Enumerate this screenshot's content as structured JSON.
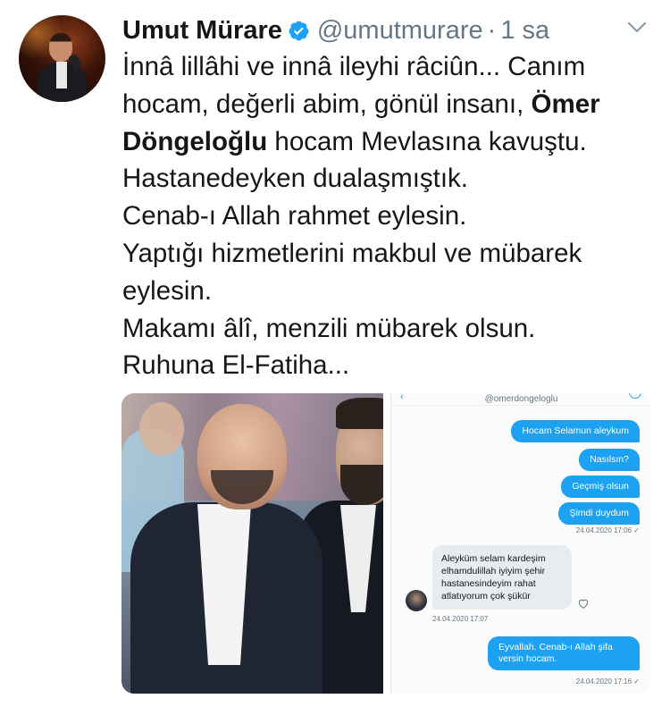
{
  "tweet": {
    "author_name": "Umut Mürare",
    "handle": "@umutmurare",
    "separator": "·",
    "time": "1 sa",
    "lines": [
      {
        "pre": "İnnâ lillâhi ve innâ ileyhi râciûn... Canım",
        "bold": "",
        "post": ""
      },
      {
        "pre": "hocam, değerli abim, gönül insanı, ",
        "bold": "Ömer",
        "post": ""
      },
      {
        "pre": "",
        "bold": "Döngeloğlu",
        "post": " hocam Mevlasına kavuştu."
      },
      {
        "pre": "Hastanedeyken dualaşmıştık.",
        "bold": "",
        "post": ""
      },
      {
        "pre": "Cenab-ı Allah rahmet eylesin.",
        "bold": "",
        "post": ""
      },
      {
        "pre": "Yaptığı hizmetlerini makbul ve mübarek",
        "bold": "",
        "post": ""
      },
      {
        "pre": "eylesin.",
        "bold": "",
        "post": ""
      },
      {
        "pre": "Makamı âlî, menzili mübarek olsun.",
        "bold": "",
        "post": ""
      },
      {
        "pre": "Ruhuna El-Fatiha...",
        "bold": "",
        "post": ""
      }
    ]
  },
  "dm": {
    "username": "@omerdongeloglu",
    "messages_out_1": [
      "Hocam Selamun aleykum",
      "Nasılsın?",
      "Geçmiş olsun",
      "Şimdi duydum"
    ],
    "stamp_1": "24.04.2020 17:06 ✓",
    "message_in": "Aleyküm selam kardeşim elhamdulillah iyiyim şehir hastanesindeyim rahat atlatıyorum çok şükür",
    "stamp_in": "24.04.2020 17:07",
    "message_out_2": "Eyvallah. Cenab-ı Allah şifa versin hocam.",
    "stamp_2": "24.04.2020 17:16 ✓"
  },
  "colors": {
    "accent": "#1da1f2",
    "text": "#14171a",
    "muted": "#657786"
  }
}
